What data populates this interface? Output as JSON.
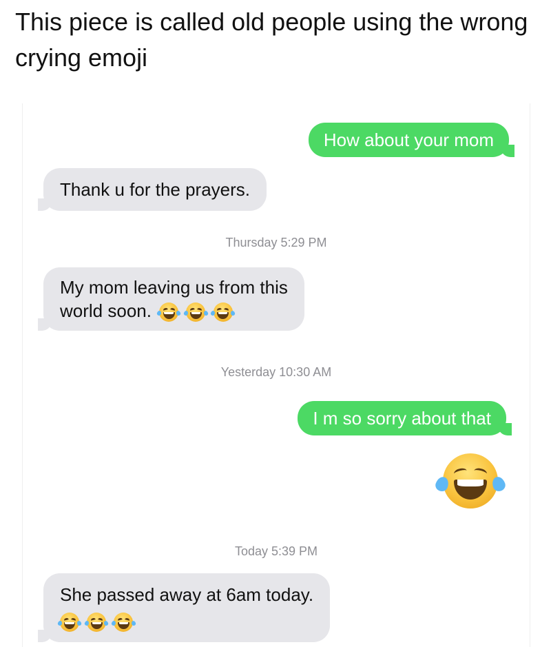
{
  "caption": "This piece is called old people using the wrong crying emoji",
  "messages": {
    "m1": "How about your mom",
    "m2": "Thank u for the prayers.",
    "ts1": "Thursday 5:29 PM",
    "m3_line1": "My mom leaving us from this",
    "m3_line2": "world soon.",
    "ts2": "Yesterday 10:30 AM",
    "m4": "I m so sorry about that",
    "ts3": "Today 5:39 PM",
    "m5": "She passed away at 6am today."
  },
  "icons": {
    "emoji": "face-with-tears-of-joy-icon"
  },
  "colors": {
    "sent_bubble": "#4cd964",
    "received_bubble": "#e6e6ea",
    "timestamp": "#8e8e93"
  }
}
